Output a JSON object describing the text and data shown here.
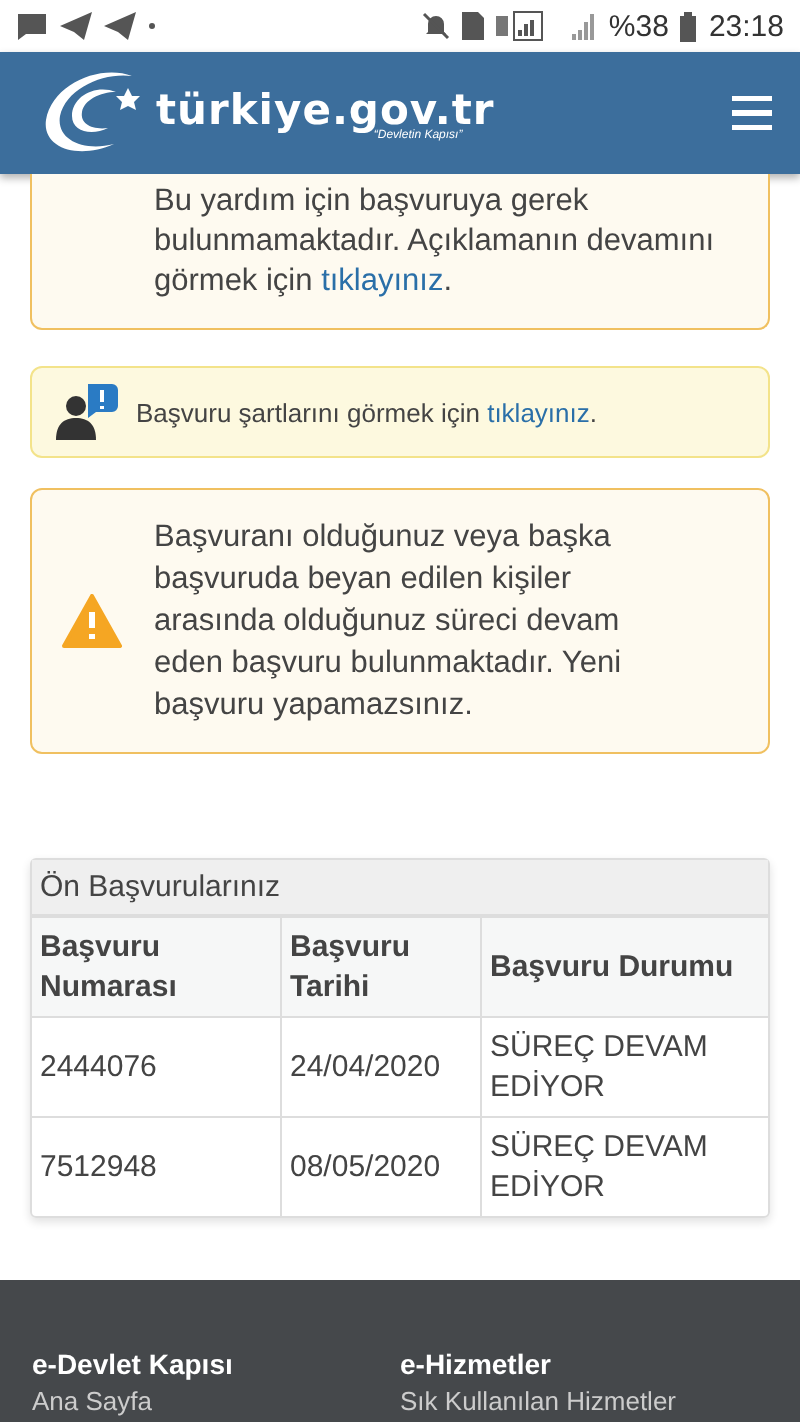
{
  "status_bar": {
    "battery": "%38",
    "time": "23:18"
  },
  "header": {
    "logo_text": "türkiye.gov.tr",
    "logo_tagline": "“Devletin Kapısı”"
  },
  "info_card": {
    "text": "Bu yardım için başvuruya gerek bulunmamaktadır. Açıklamanın devamını görmek için ",
    "link": "tıklayınız",
    "suffix": "."
  },
  "conditions_notice": {
    "text": "Başvuru şartlarını görmek için ",
    "link": "tıklayınız",
    "suffix": "."
  },
  "warning": {
    "text": "Başvuranı olduğunuz veya başka başvuruda beyan edilen kişiler arasında olduğunuz süreci devam eden başvuru bulunmaktadır. Yeni başvuru yapamazsınız."
  },
  "applications": {
    "title": "Ön Başvurularınız",
    "columns": [
      "Başvuru Numarası",
      "Başvuru Tarihi",
      "Başvuru Durumu"
    ],
    "rows": [
      [
        "2444076",
        "24/04/2020",
        "SÜREÇ DEVAM EDİYOR"
      ],
      [
        "7512948",
        "08/05/2020",
        "SÜREÇ DEVAM EDİYOR"
      ]
    ]
  },
  "footer": {
    "columns": [
      {
        "heading": "e-Devlet Kapısı",
        "links": [
          "Ana Sayfa"
        ]
      },
      {
        "heading": "e-Hizmetler",
        "links": [
          "Sık Kullanılan Hizmetler"
        ]
      }
    ]
  }
}
